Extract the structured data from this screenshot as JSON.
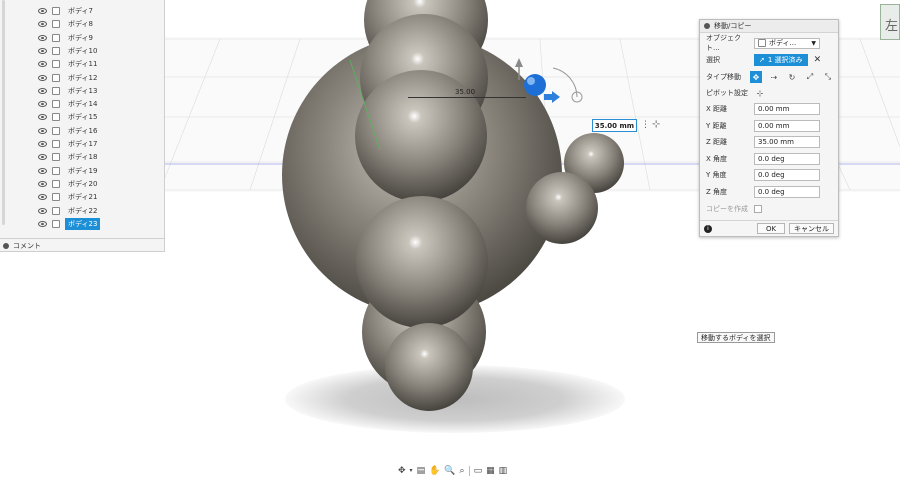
{
  "browser": {
    "items": [
      {
        "label": "ボディ7"
      },
      {
        "label": "ボディ8"
      },
      {
        "label": "ボディ9"
      },
      {
        "label": "ボディ10"
      },
      {
        "label": "ボディ11"
      },
      {
        "label": "ボディ12"
      },
      {
        "label": "ボディ13"
      },
      {
        "label": "ボディ14"
      },
      {
        "label": "ボディ15"
      },
      {
        "label": "ボディ16"
      },
      {
        "label": "ボディ17"
      },
      {
        "label": "ボディ18"
      },
      {
        "label": "ボディ19"
      },
      {
        "label": "ボディ20"
      },
      {
        "label": "ボディ21"
      },
      {
        "label": "ボディ22"
      },
      {
        "label": "ボディ23",
        "selected": true
      }
    ],
    "comments_label": "コメント"
  },
  "viewport": {
    "dimension_label": "35.00",
    "dimension_input": "35.00 mm",
    "tooltip": "移動するボディを選択",
    "viewcube_label": "左",
    "body_color": "#8a857c"
  },
  "dialog": {
    "title": "移動/コピー",
    "object_label": "オブジェクト...",
    "object_value": "ボディ...",
    "selection_label": "選択",
    "selection_value": "1 選択済み",
    "type_label": "タイプ移動",
    "pivot_label": "ピボット設定",
    "fields": [
      {
        "label": "X 距離",
        "value": "0.00 mm"
      },
      {
        "label": "Y 距離",
        "value": "0.00 mm"
      },
      {
        "label": "Z 距離",
        "value": "35.00 mm"
      },
      {
        "label": "X 角度",
        "value": "0.0 deg"
      },
      {
        "label": "Y 角度",
        "value": "0.0 deg"
      },
      {
        "label": "Z 角度",
        "value": "0.0 deg"
      }
    ],
    "create_copy_label": "コピーを作成",
    "ok_label": "OK",
    "cancel_label": "キャンセル",
    "accent_color": "#1d8fd6"
  }
}
